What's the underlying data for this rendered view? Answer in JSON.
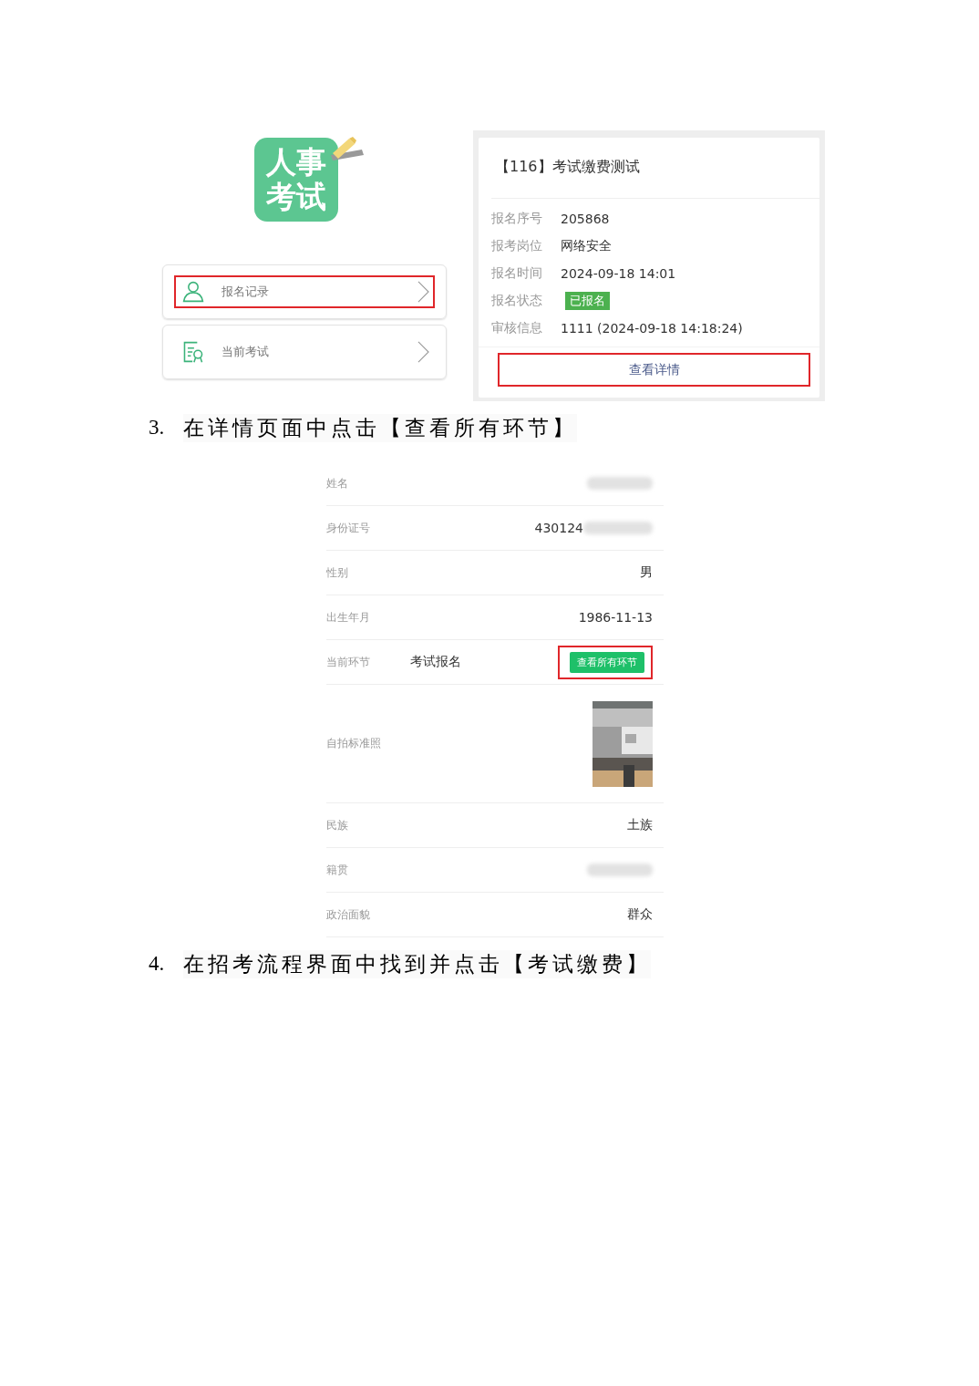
{
  "app_logo": {
    "lines": [
      "人事",
      "考试"
    ]
  },
  "menu": [
    {
      "label": "报名记录",
      "highlighted": true
    },
    {
      "label": "当前考试",
      "highlighted": false
    }
  ],
  "record_card": {
    "title": "【116】考试缴费测试",
    "fields": [
      {
        "label": "报名序号",
        "value": "205868",
        "kind": "text"
      },
      {
        "label": "报考岗位",
        "value": "网络安全",
        "kind": "text"
      },
      {
        "label": "报名时间",
        "value": "2024-09-18 14:01",
        "kind": "text"
      },
      {
        "label": "报名状态",
        "value": "已报名",
        "kind": "badge"
      },
      {
        "label": "审核信息",
        "value": "1111 (2024-09-18 14:18:24)",
        "kind": "text"
      }
    ],
    "button": {
      "label": "查看详情",
      "highlighted": true
    }
  },
  "step_3": {
    "number": "3.",
    "text": "在详情页面中点击【查看所有环节】"
  },
  "details": [
    {
      "kind": "text",
      "label": "姓名",
      "blurred": true
    },
    {
      "kind": "text",
      "label": "身份证号",
      "value": "430124",
      "blurred": true
    },
    {
      "kind": "text",
      "label": "性别",
      "value": "男",
      "blurred": false
    },
    {
      "kind": "text",
      "label": "出生年月",
      "value": "1986-11-13",
      "blurred": false
    },
    {
      "kind": "stage",
      "label": "当前环节",
      "value": "考试报名",
      "button": "查看所有环节",
      "highlighted": true
    },
    {
      "label": "自拍标准照"
    },
    {
      "kind": "text",
      "label": "民族",
      "value": "土族",
      "blurred": false
    },
    {
      "kind": "text",
      "label": "籍贯",
      "blurred": true
    },
    {
      "kind": "text",
      "label": "政治面貌",
      "value": "群众",
      "blurred": false
    }
  ],
  "step_4": {
    "number": "4.",
    "text": "在招考流程界面中找到并点击【考试缴费】"
  }
}
